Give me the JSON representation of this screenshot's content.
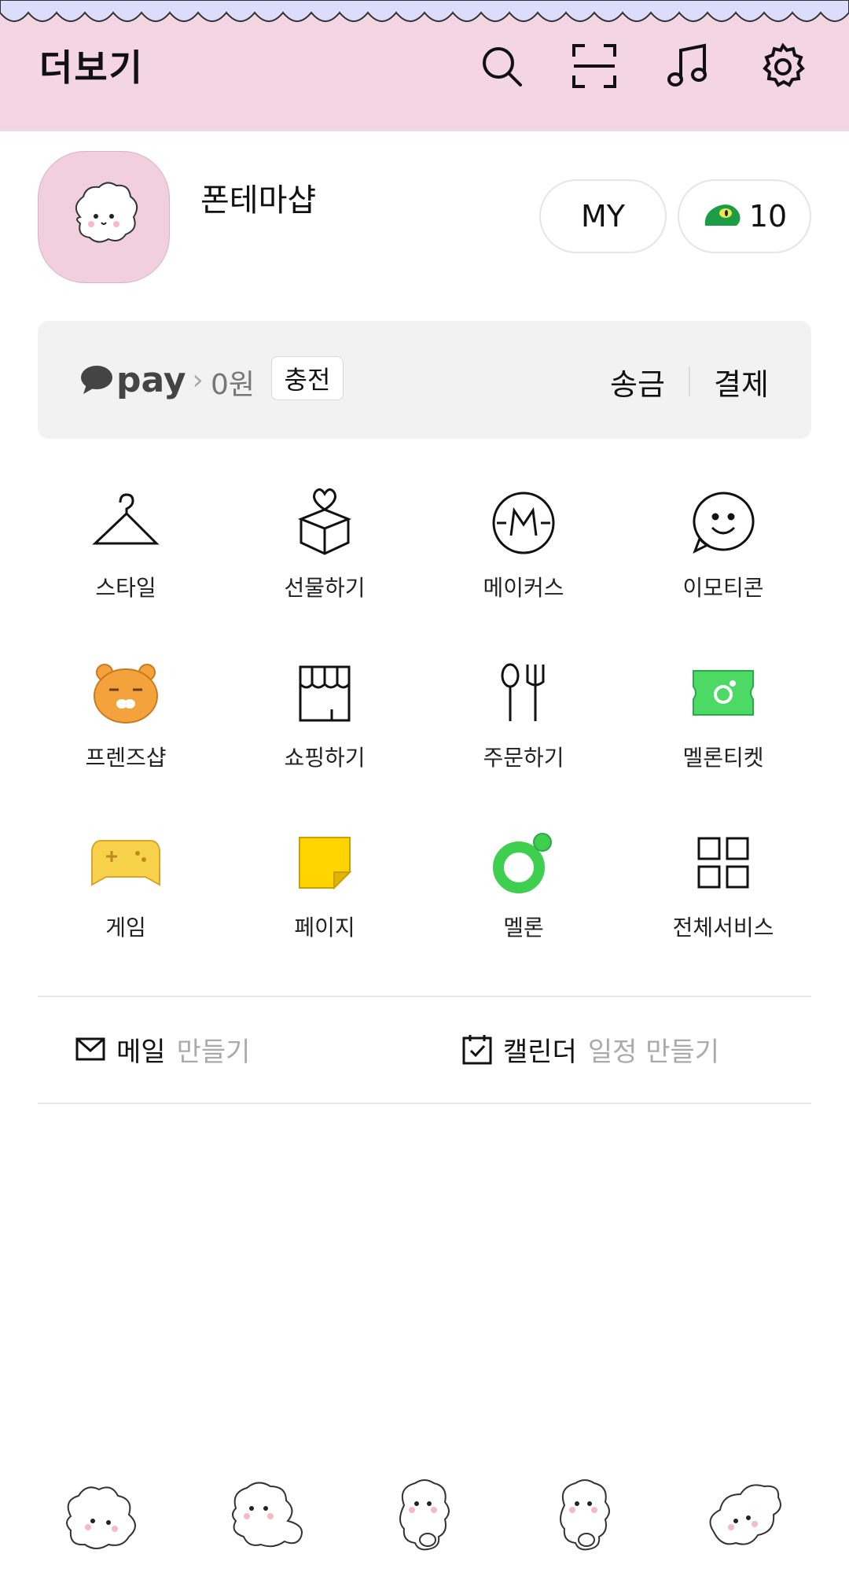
{
  "header": {
    "title": "더보기",
    "accent_color": "#f4d6e3",
    "scallop_color": "#dcdcfb",
    "icons": [
      "search-icon",
      "scan-icon",
      "music-icon",
      "settings-icon"
    ]
  },
  "profile": {
    "name": "폰테마샵",
    "my_label": "MY",
    "coin_count": "10"
  },
  "pay": {
    "logo_text": "pay",
    "amount": "0원",
    "charge_label": "충전",
    "send_label": "송금",
    "payment_label": "결제"
  },
  "services": [
    {
      "label": "스타일",
      "icon": "hanger-icon"
    },
    {
      "label": "선물하기",
      "icon": "gift-box-icon"
    },
    {
      "label": "메이커스",
      "icon": "makers-icon"
    },
    {
      "label": "이모티콘",
      "icon": "emoticon-icon"
    },
    {
      "label": "프렌즈샵",
      "icon": "ryan-icon"
    },
    {
      "label": "쇼핑하기",
      "icon": "store-icon"
    },
    {
      "label": "주문하기",
      "icon": "utensils-icon"
    },
    {
      "label": "멜론티켓",
      "icon": "ticket-icon"
    },
    {
      "label": "게임",
      "icon": "gamepad-icon"
    },
    {
      "label": "페이지",
      "icon": "page-icon"
    },
    {
      "label": "멜론",
      "icon": "melon-icon"
    },
    {
      "label": "전체서비스",
      "icon": "all-services-icon"
    }
  ],
  "quick": {
    "mail_title": "메일",
    "mail_action": "만들기",
    "calendar_title": "캘린더",
    "calendar_action": "일정 만들기"
  },
  "bottom_nav": [
    "friends-tab",
    "chats-tab",
    "view-tab",
    "shopping-tab",
    "more-tab"
  ]
}
